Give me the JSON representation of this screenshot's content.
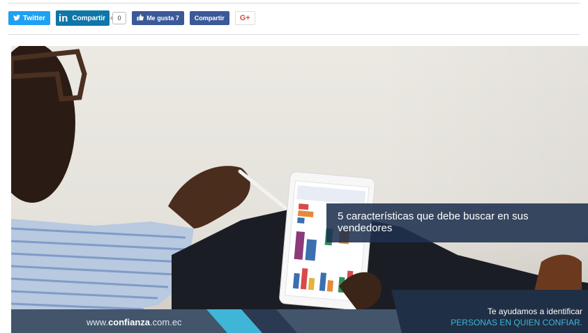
{
  "share_bar": {
    "twitter_label": "Twitter",
    "linkedin_label": "Compartir",
    "linkedin_count": "0",
    "facebook_like_label": "Me gusta 7",
    "facebook_share_label": "Compartir",
    "googleplus_label": "G+"
  },
  "hero": {
    "caption": "5 características que debe buscar en sus vendedores",
    "footer_url_prefix": "www.",
    "footer_url_brand": "confianza",
    "footer_url_suffix": ".com.ec",
    "footer_line1": "Te ayudamos a identificar",
    "footer_line2": "PERSONAS EN QUIEN CONFIAR."
  },
  "colors": {
    "twitter": "#1da1f2",
    "linkedin": "#0e76a8",
    "facebook": "#3b5998",
    "googleplus": "#dd4b39",
    "caption_bg": "#1f314f",
    "accent_cyan": "#3fb6d8"
  }
}
